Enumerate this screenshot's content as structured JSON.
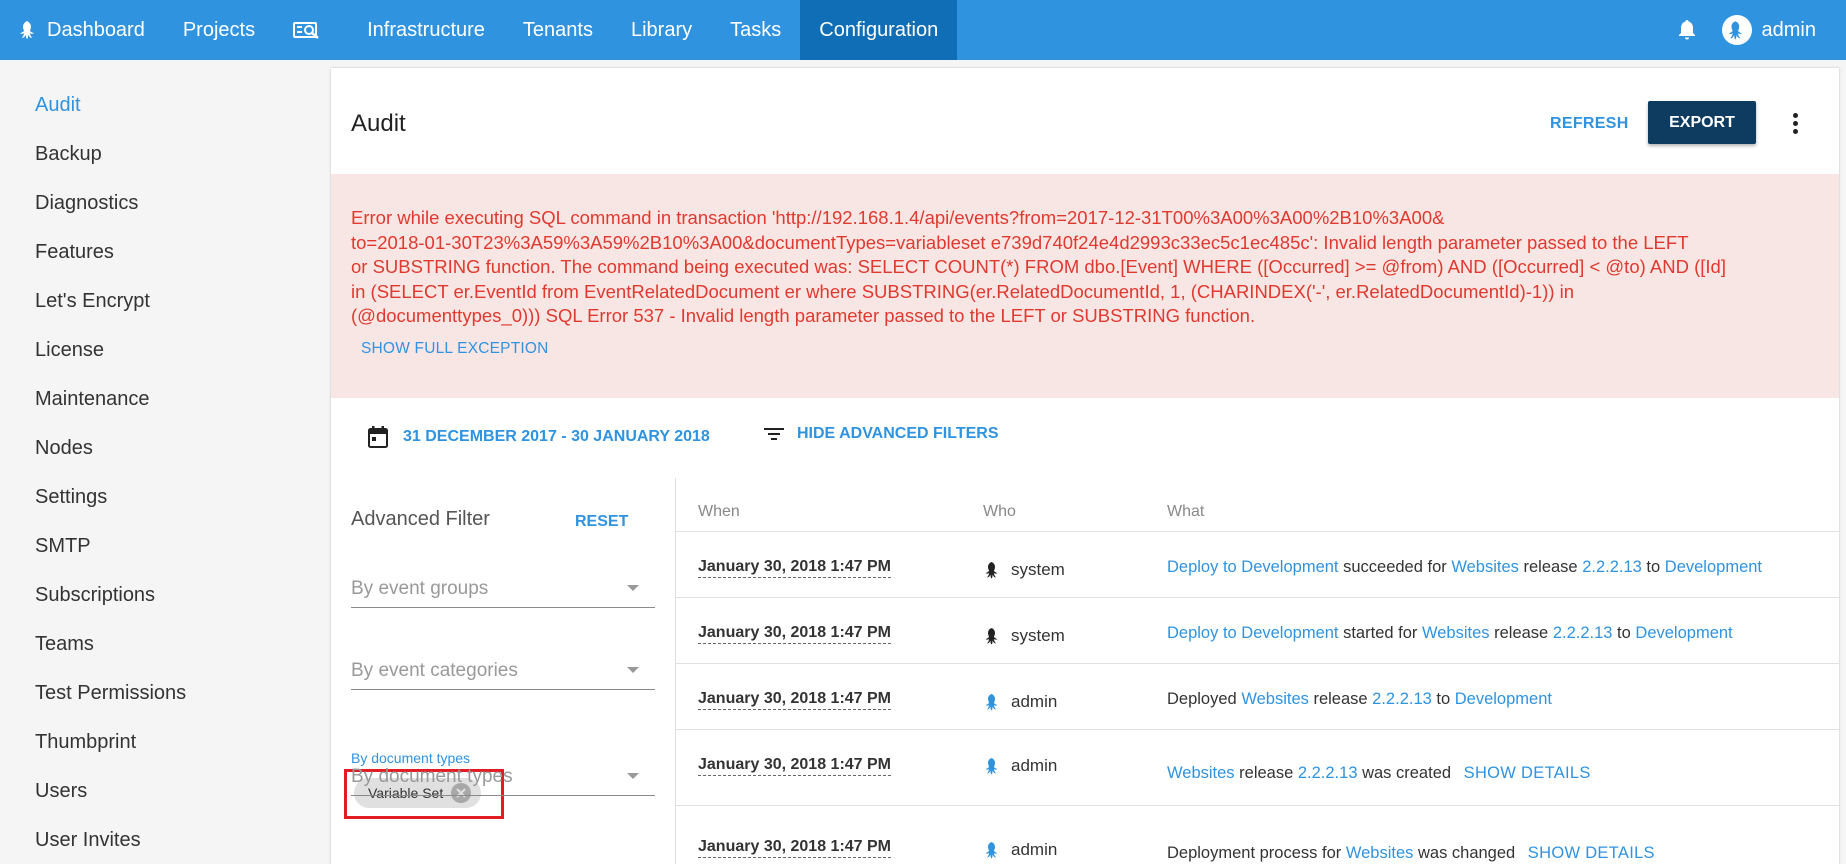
{
  "nav": {
    "items": [
      {
        "label": "Dashboard",
        "icon": "octopus-logo-icon"
      },
      {
        "label": "Projects"
      },
      {
        "label": "",
        "icon": "search-machines-icon"
      },
      {
        "label": "Infrastructure"
      },
      {
        "label": "Tenants"
      },
      {
        "label": "Library"
      },
      {
        "label": "Tasks"
      },
      {
        "label": "Configuration",
        "active": true
      }
    ],
    "user": "admin",
    "bell_icon": "bell-icon",
    "brand_color": "#2f93e0",
    "active_color": "#0f6eb5"
  },
  "sidebar": {
    "items": [
      {
        "label": "Audit",
        "active": true
      },
      {
        "label": "Backup"
      },
      {
        "label": "Diagnostics"
      },
      {
        "label": "Features"
      },
      {
        "label": "Let's Encrypt"
      },
      {
        "label": "License"
      },
      {
        "label": "Maintenance"
      },
      {
        "label": "Nodes"
      },
      {
        "label": "Settings"
      },
      {
        "label": "SMTP"
      },
      {
        "label": "Subscriptions"
      },
      {
        "label": "Teams"
      },
      {
        "label": "Test Permissions"
      },
      {
        "label": "Thumbprint"
      },
      {
        "label": "Users"
      },
      {
        "label": "User Invites"
      }
    ]
  },
  "main": {
    "title": "Audit",
    "refresh_label": "REFRESH",
    "export_label": "EXPORT",
    "error": {
      "lines": [
        "Error while executing SQL command in transaction 'http://192.168.1.4/api/events?from=2017-12-31T00%3A00%3A00%2B10%3A00&",
        "to=2018-01-30T23%3A59%3A59%2B10%3A00&documentTypes=variableset e739d740f24e4d2993c33ec5c1ec485c': Invalid length parameter passed to the LEFT",
        "or SUBSTRING function. The command being executed was: SELECT COUNT(*) FROM dbo.[Event] WHERE ([Occurred] >= @from) AND ([Occurred] < @to) AND ([Id]",
        "in (SELECT er.EventId from EventRelatedDocument er where SUBSTRING(er.RelatedDocumentId, 1, (CHARINDEX('-', er.RelatedDocumentId)-1)) in",
        "(@documenttypes_0))) SQL Error 537 - Invalid length parameter passed to the LEFT or SUBSTRING function."
      ],
      "show_full_label": "SHOW FULL EXCEPTION",
      "text_color": "#e0392f",
      "bg_color": "#f8e6e4"
    },
    "date_range_label": "31 DECEMBER 2017 - 30 JANUARY 2018",
    "advanced_toggle_label": "HIDE ADVANCED FILTERS",
    "advanced_filter": {
      "title": "Advanced Filter",
      "reset_label": "RESET",
      "event_groups_placeholder": "By event groups",
      "event_categories_placeholder": "By event categories",
      "document_types_label": "By document types",
      "document_types_chip": "Variable Set",
      "document_types_placeholder": "By document types"
    },
    "table": {
      "headers": {
        "when": "When",
        "who": "Who",
        "what": "What"
      },
      "rows": [
        {
          "when": "January 30, 2018 1:47 PM",
          "who": "system",
          "who_icon": "system-octopus-icon",
          "what": [
            {
              "t": "Deploy to Development",
              "link": true
            },
            {
              "t": " succeeded for "
            },
            {
              "t": "Websites",
              "link": true
            },
            {
              "t": " release "
            },
            {
              "t": "2.2.2.13",
              "link": true
            },
            {
              "t": " to "
            },
            {
              "t": "Development",
              "link": true
            }
          ]
        },
        {
          "when": "January 30, 2018 1:47 PM",
          "who": "system",
          "who_icon": "system-octopus-icon",
          "what": [
            {
              "t": "Deploy to Development",
              "link": true
            },
            {
              "t": " started for "
            },
            {
              "t": "Websites",
              "link": true
            },
            {
              "t": " release "
            },
            {
              "t": "2.2.2.13",
              "link": true
            },
            {
              "t": " to "
            },
            {
              "t": "Development",
              "link": true
            }
          ]
        },
        {
          "when": "January 30, 2018 1:47 PM",
          "who": "admin",
          "who_icon": "user-octopus-icon",
          "what": [
            {
              "t": "Deployed "
            },
            {
              "t": "Websites",
              "link": true
            },
            {
              "t": " release "
            },
            {
              "t": "2.2.2.13",
              "link": true
            },
            {
              "t": " to "
            },
            {
              "t": "Development",
              "link": true
            }
          ]
        },
        {
          "when": "January 30, 2018 1:47 PM",
          "who": "admin",
          "who_icon": "user-octopus-icon",
          "what": [
            {
              "t": "Websites",
              "link": true
            },
            {
              "t": " release "
            },
            {
              "t": "2.2.2.13",
              "link": true
            },
            {
              "t": " was created "
            }
          ],
          "show_details": "SHOW DETAILS"
        },
        {
          "when": "January 30, 2018 1:47 PM",
          "who": "admin",
          "who_icon": "user-octopus-icon",
          "what": [
            {
              "t": "Deployment process for "
            },
            {
              "t": "Websites",
              "link": true
            },
            {
              "t": " was changed "
            }
          ],
          "show_details": "SHOW DETAILS"
        }
      ]
    }
  }
}
